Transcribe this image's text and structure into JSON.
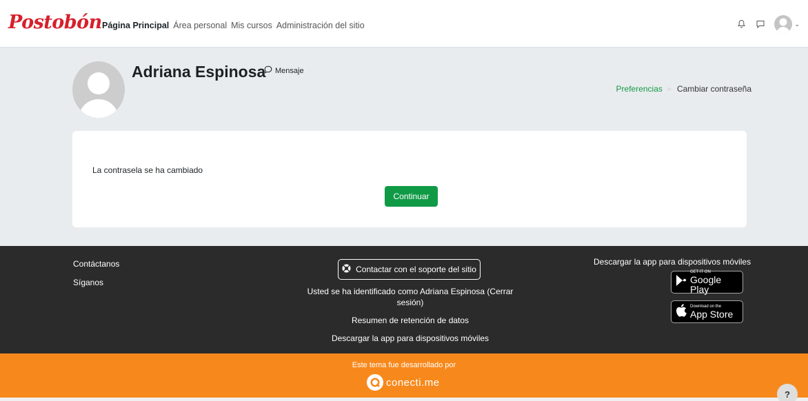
{
  "nav": {
    "brand": "Postobón",
    "links": [
      {
        "label": "Página Principal",
        "active": true
      },
      {
        "label": "Área personal",
        "active": false
      },
      {
        "label": "Mis cursos",
        "active": false
      },
      {
        "label": "Administración del sitio",
        "active": false
      }
    ],
    "icons": [
      "bell-icon",
      "chat-icon",
      "user-avatar-icon",
      "chevron-down-icon"
    ],
    "chevron": "⌄"
  },
  "header": {
    "user_name": "Adriana Espinosa",
    "message_label": "Mensaje",
    "breadcrumb": [
      {
        "label": "Preferencias",
        "link": true
      },
      {
        "label": "Cambiar contraseña",
        "link": false
      }
    ]
  },
  "card": {
    "message": "La contrasela se ha cambiado",
    "continue_label": "Continuar"
  },
  "footer": {
    "contact": "Contáctanos",
    "follow": "Síganos",
    "support_label": "Contactar con el soporte del sitio",
    "logged_in": "Usted se ha identificado como Adriana Espinosa (Cerrar sesión)",
    "data_retention": "Resumen de retención de datos",
    "download_app": "Descargar la app para dispositivos móviles",
    "download_app_title": "Descargar la app para dispositivos móviles",
    "google_small": "GET IT ON",
    "google_big": "Google Play",
    "apple_small": "Download on the",
    "apple_big": "App Store"
  },
  "band": {
    "developed_by": "Este tema fue desarrollado por",
    "logo_word": "conecti.me"
  },
  "help": {
    "label": "?"
  },
  "colors": {
    "brand_red": "#d7202b",
    "accent_green": "#109a46",
    "footer_bg": "#2b2b2b",
    "band_orange": "#f7891c"
  }
}
